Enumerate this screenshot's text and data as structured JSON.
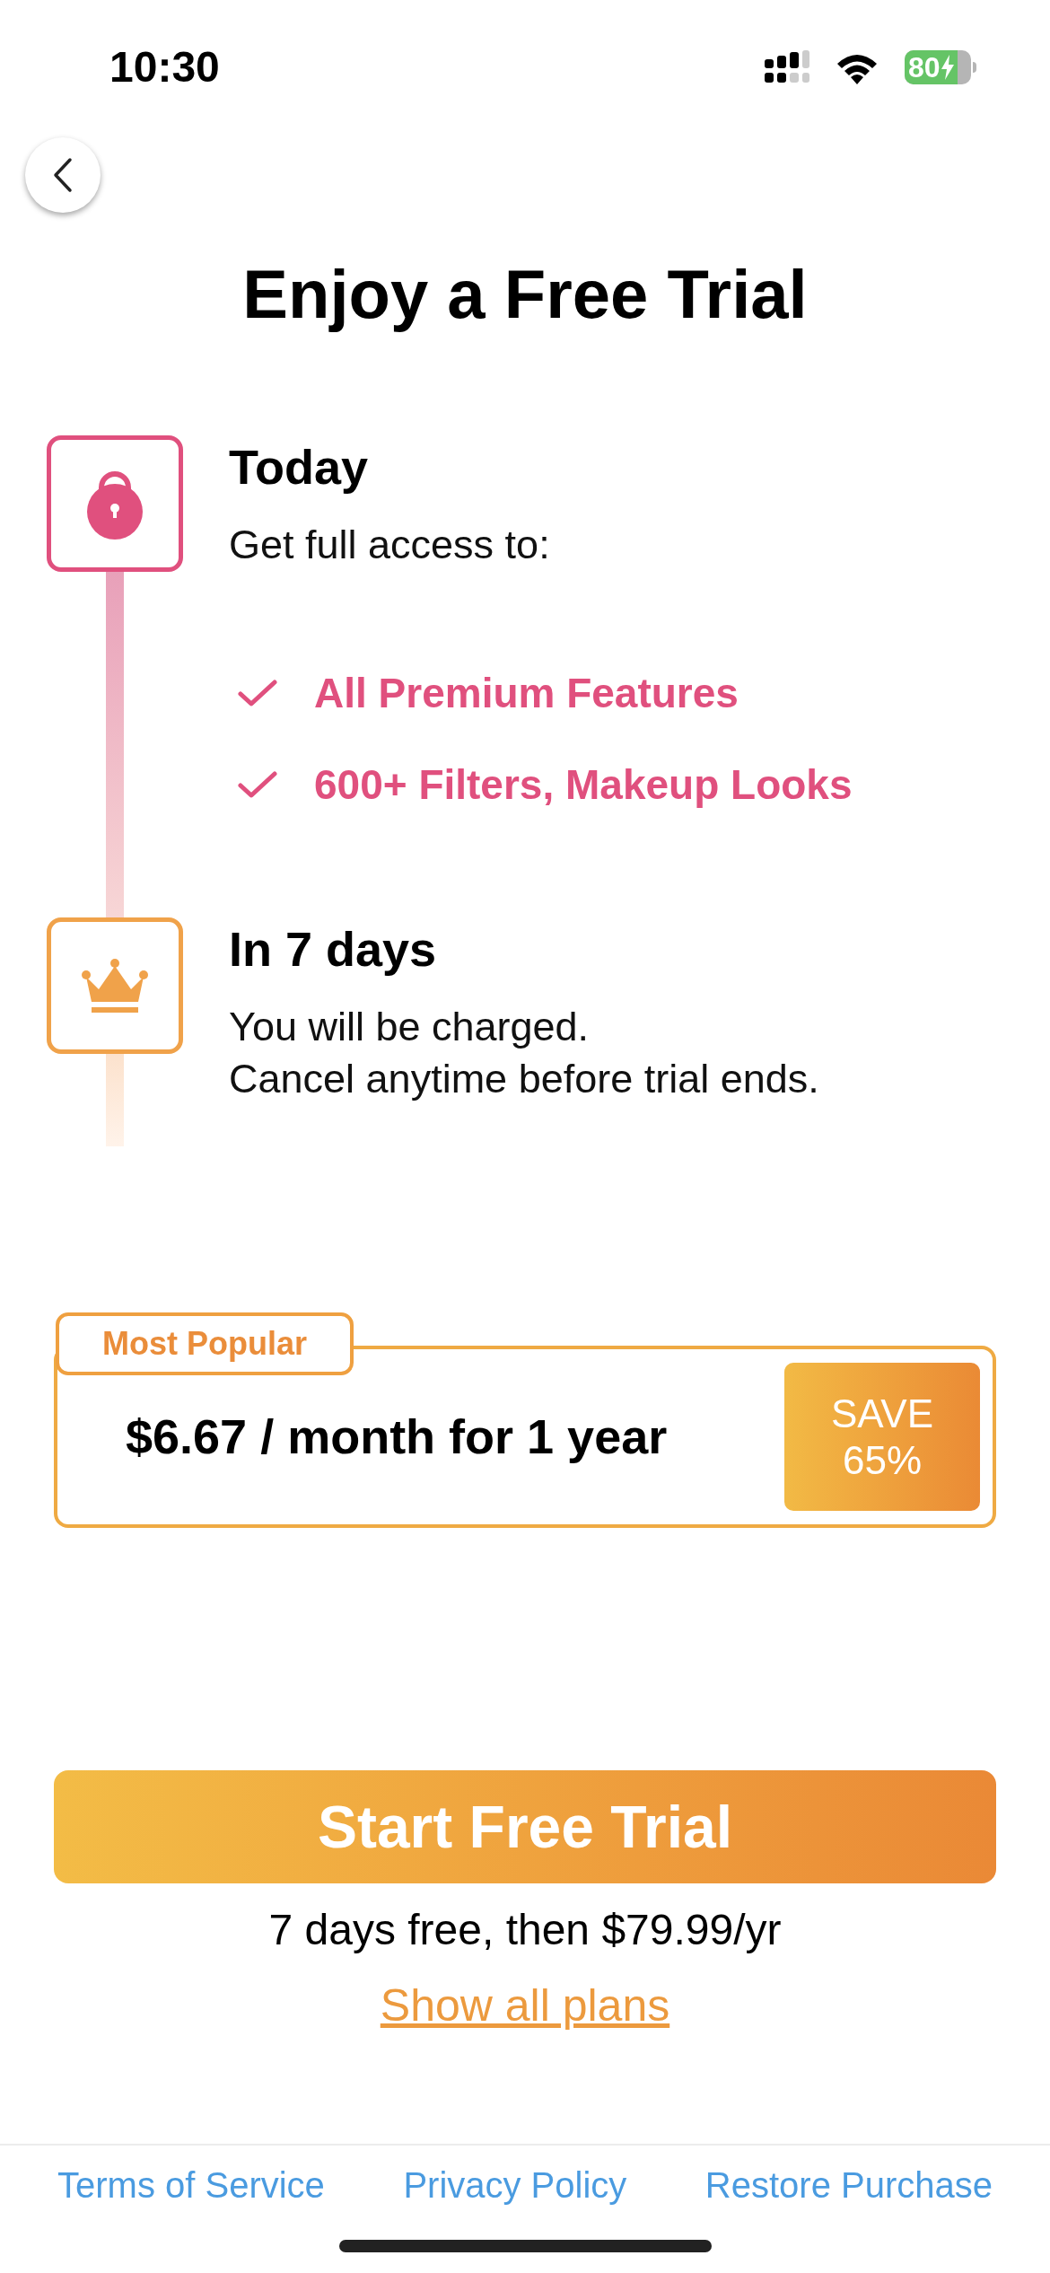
{
  "status_bar": {
    "time": "10:30",
    "battery": "80"
  },
  "title": "Enjoy a Free Trial",
  "steps": [
    {
      "kind": "lock",
      "title": "Today",
      "description": [
        "Get full access to:"
      ],
      "features": [
        "All Premium Features",
        "600+ Filters, Makeup Looks"
      ]
    },
    {
      "kind": "crown",
      "title": "In 7 days",
      "description": [
        "You will be charged.",
        "Cancel anytime before trial ends."
      ]
    }
  ],
  "plan": {
    "badge": "Most Popular",
    "price": "$6.67 / month for 1 year",
    "save": [
      "SAVE",
      "65%"
    ]
  },
  "cta": "Start Free Trial",
  "terms": "7 days free, then $79.99/yr",
  "show_plans": "Show all plans",
  "footer_links": [
    "Terms of Service",
    "Privacy Policy",
    "Restore Purchase"
  ]
}
